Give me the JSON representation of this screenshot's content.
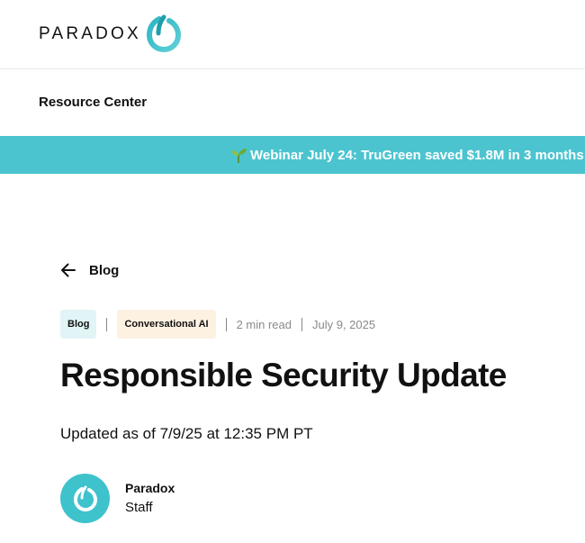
{
  "brand": {
    "name": "PARADOX",
    "accent": "#4cc4cf"
  },
  "nav": {
    "resource_center": "Resource Center"
  },
  "banner": {
    "text": "Webinar July 24: TruGreen saved $1.8M in 3 months",
    "icon": "sprout-icon",
    "background": "#4cc4cf"
  },
  "back_link": {
    "label": "Blog",
    "icon": "arrow-left-icon"
  },
  "meta": {
    "tags": [
      "Blog",
      "Conversational AI"
    ],
    "read_time": "2 min read",
    "date": "July 9, 2025"
  },
  "article": {
    "title": "Responsible Security Update",
    "updated": "Updated as of 7/9/25 at 12:35 PM PT"
  },
  "author": {
    "name": "Paradox",
    "role": "Staff"
  }
}
